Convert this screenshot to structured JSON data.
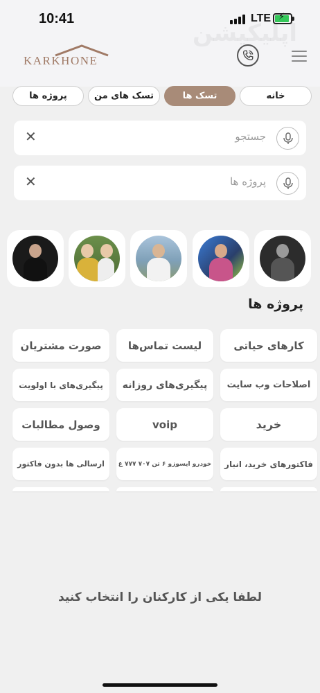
{
  "status_bar": {
    "time": "10:41",
    "network": "LTE",
    "icons": [
      "signal-icon",
      "battery-charging-icon"
    ],
    "battery_color": "#34c759"
  },
  "header": {
    "logo_text": "KARKHONE",
    "watermark_text": "اپلیکیشن",
    "call_icon": "phone-call-icon",
    "menu_icon": "hamburger-menu-icon"
  },
  "tabs": [
    {
      "label": "خانه",
      "active": false
    },
    {
      "label": "تسک ها",
      "active": true
    },
    {
      "label": "تسک های من",
      "active": false
    },
    {
      "label": "پروژه ها",
      "active": false
    }
  ],
  "search": {
    "placeholder": "جستجو",
    "clear_icon": "close-icon",
    "mic_icon": "microphone-icon"
  },
  "project_search": {
    "placeholder": "پروژه ها",
    "clear_icon": "close-icon",
    "mic_icon": "microphone-icon"
  },
  "avatars": [
    {
      "name": "employee-avatar-1"
    },
    {
      "name": "employee-avatar-2"
    },
    {
      "name": "employee-avatar-3"
    },
    {
      "name": "employee-avatar-4"
    },
    {
      "name": "employee-avatar-5"
    }
  ],
  "projects_title": "پروژه ها",
  "projects": [
    "کارهای حیاتی",
    "لیست تماس‌ها",
    "صورت مشتریان",
    "اصلاحات وب سایت",
    "پیگیری‌های روزانه",
    "پیگیری‌های با اولویت",
    "خرید",
    "voip",
    "وصول مطالبات",
    "فاکتورهای خرید، انبار",
    "خودرو ایسوزو ۶ تن ۷۰۷ ۷۷۷ ع",
    "ارسالی ها بدون فاکتور"
  ],
  "prompt": "لطفا یکی از کارکنان را انتخاب کنید",
  "colors": {
    "accent": "#a88b78",
    "logo": "#a07a66",
    "background": "#f0f0f0"
  }
}
